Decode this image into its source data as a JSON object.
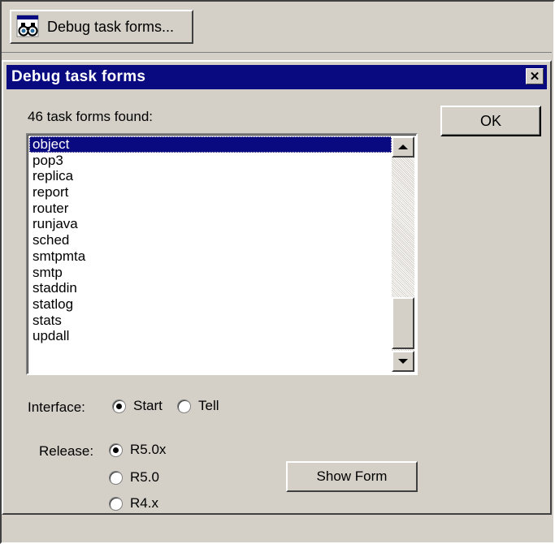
{
  "toolbar": {
    "button_label": "Debug task forms...",
    "button_icon": "binoculars-icon"
  },
  "dialog": {
    "title": "Debug task forms",
    "close_glyph": "✕",
    "found_label": "46 task forms found:",
    "ok_label": "OK",
    "task_forms": [
      {
        "name": "object",
        "selected": true
      },
      {
        "name": "pop3",
        "selected": false
      },
      {
        "name": "replica",
        "selected": false
      },
      {
        "name": "report",
        "selected": false
      },
      {
        "name": "router",
        "selected": false
      },
      {
        "name": "runjava",
        "selected": false
      },
      {
        "name": "sched",
        "selected": false
      },
      {
        "name": "smtpmta",
        "selected": false
      },
      {
        "name": "smtp",
        "selected": false
      },
      {
        "name": "staddin",
        "selected": false
      },
      {
        "name": "statlog",
        "selected": false
      },
      {
        "name": "stats",
        "selected": false
      },
      {
        "name": "updall",
        "selected": false
      }
    ],
    "interface": {
      "label": "Interface:",
      "options": [
        {
          "label": "Start",
          "checked": true
        },
        {
          "label": "Tell",
          "checked": false
        }
      ]
    },
    "release": {
      "label": "Release:",
      "options": [
        {
          "label": "R5.0x",
          "checked": true
        },
        {
          "label": "R5.0",
          "checked": false
        },
        {
          "label": "R4.x",
          "checked": false
        }
      ]
    },
    "show_form_label": "Show Form"
  },
  "colors": {
    "title_bar": "#0a0a80",
    "selection": "#0a0a80",
    "face": "#d4d0c8"
  }
}
